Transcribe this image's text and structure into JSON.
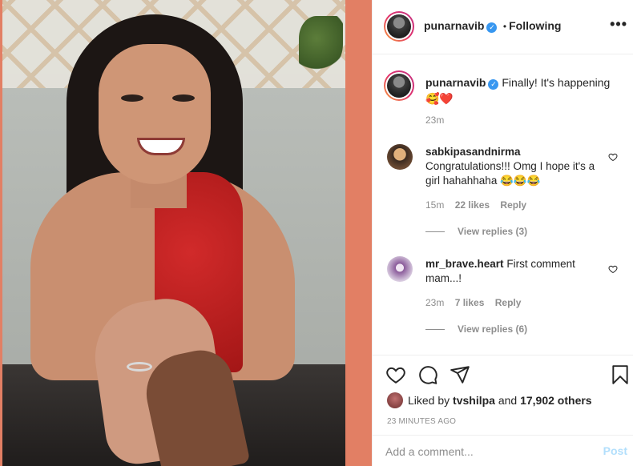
{
  "colors": {
    "background": "#e27f64",
    "verified": "#3897f0",
    "post_disabled": "#b2dffc",
    "muted": "#8e8e8e"
  },
  "header": {
    "username": "punarnavib",
    "separator": "•",
    "following_label": "Following",
    "more_icon": "more-horizontal-icon"
  },
  "caption": {
    "username": "punarnavib",
    "text": "Finally! It's happening",
    "emoji": "🥰❤️",
    "time": "23m"
  },
  "comments": [
    {
      "username": "sabkipasandnirma",
      "text": "Congratulations!!! Omg I hope it's a girl hahahhaha 😂😂😂",
      "time": "15m",
      "likes": "22 likes",
      "reply_label": "Reply",
      "view_replies": "View replies (3)"
    },
    {
      "username": "mr_brave.heart",
      "text": "First comment mam...!",
      "time": "23m",
      "likes": "7 likes",
      "reply_label": "Reply",
      "view_replies": "View replies (6)"
    }
  ],
  "actions": {
    "like_icon": "heart-icon",
    "comment_icon": "comment-icon",
    "share_icon": "share-icon",
    "save_icon": "bookmark-icon"
  },
  "likes": {
    "prefix": "Liked by",
    "user": "tvshilpa",
    "middle": "and",
    "count": "17,902 others"
  },
  "timestamp": "23 MINUTES AGO",
  "add_comment": {
    "placeholder": "Add a comment...",
    "post_label": "Post"
  }
}
